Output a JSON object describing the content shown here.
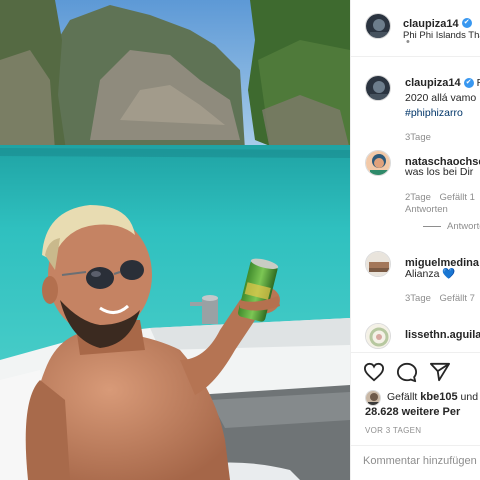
{
  "header": {
    "username": "claupiza14",
    "verified_mark": "✔",
    "separator": "•",
    "location": "Phi Phi Islands Tha"
  },
  "caption": {
    "username": "claupiza14",
    "truncated_tail": "R",
    "line1": "2020 allá vamo",
    "hashtag": "#phiphizarro",
    "time": "3Tage"
  },
  "comments": [
    {
      "username": "nataschaochse",
      "text": "was los bei Dir",
      "time": "2Tage",
      "likes": "Gefällt 1",
      "reply_label": "Antworten",
      "view_replies": "Antworte"
    },
    {
      "username": "miguelmedina",
      "text": "Alianza",
      "heart_emoji": "💙",
      "time": "3Tage",
      "likes": "Gefällt 7"
    },
    {
      "username": "lissethn.aguilar"
    }
  ],
  "actions": {
    "like_icon": "heart-outline-icon",
    "comment_icon": "speech-bubble-icon",
    "share_icon": "paper-plane-icon"
  },
  "likes": {
    "line1_prefix": "Gefällt",
    "line1_user": "kbe105",
    "line1_suffix": "und",
    "line2_count": "28.628",
    "line2_suffix": "weitere Per"
  },
  "post_time": "VOR 3 TAGEN",
  "add_comment": {
    "placeholder": "Kommentar hinzufügen"
  },
  "colors": {
    "verified": "#3897f0",
    "water": "#3fc4c4",
    "sky": "#7fb4e2",
    "heart_blue": "#3897f0"
  }
}
